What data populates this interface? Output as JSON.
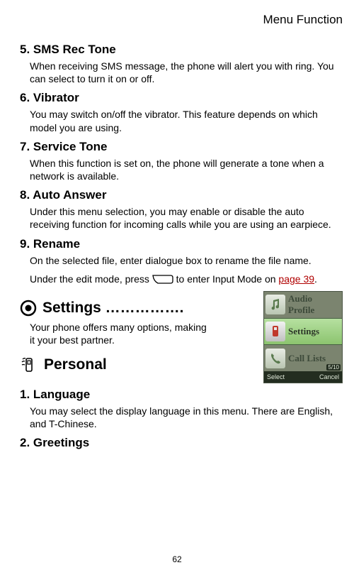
{
  "header": {
    "title": "Menu Function"
  },
  "sections": {
    "s5": {
      "heading": "5. SMS Rec Tone",
      "body": "When receiving SMS message, the phone will alert you with ring. You can select to turn it on or off."
    },
    "s6": {
      "heading": "6. Vibrator",
      "body": "You may switch on/off the vibrator. This feature depends on which model you are using."
    },
    "s7": {
      "heading": "7. Service Tone",
      "body": "When this function is set on, the phone will generate a tone when a network is available."
    },
    "s8": {
      "heading": "8. Auto Answer",
      "body": "Under this menu selection, you may enable or disable the auto receiving function for incoming calls while you are using an earpiece."
    },
    "s9": {
      "heading": "9. Rename",
      "body1": "On the selected file, enter dialogue box to rename the file name.",
      "body2a": "Under the edit mode, press",
      "body2b": " to enter Input Mode on ",
      "link": "page 39",
      "body2c": "."
    },
    "settings": {
      "heading": "Settings …………….",
      "body": "Your phone offers many options, making it your best partner."
    },
    "personal": {
      "heading": "Personal"
    },
    "lang": {
      "heading": "1. Language",
      "body": "You may select the display language in this menu.    There are English, and T-Chinese."
    },
    "greet": {
      "heading": "2. Greetings"
    }
  },
  "phone_menu": {
    "items": [
      "Audio Profile",
      "Settings",
      "Call Lists"
    ],
    "selected_index": 1,
    "counter": "5/10",
    "softkeys": {
      "left": "Select",
      "right": "Cancel"
    }
  },
  "page_number": "62"
}
